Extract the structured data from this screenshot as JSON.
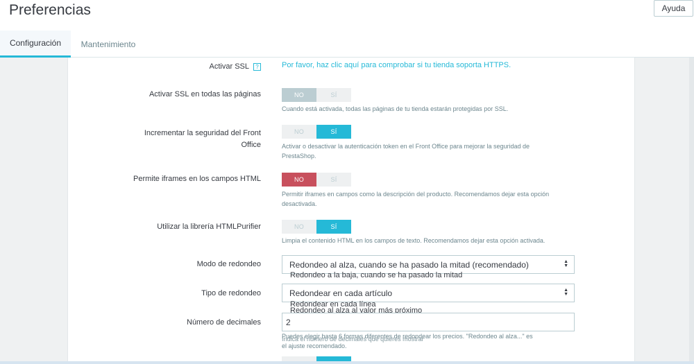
{
  "header": {
    "title": "Preferencias",
    "help_label": "Ayuda",
    "tabs": [
      {
        "label": "Configuración",
        "active": true
      },
      {
        "label": "Mantenimiento",
        "active": false
      }
    ]
  },
  "settings": {
    "ssl": {
      "label": "Activar SSL",
      "help_icon": "?",
      "link": "Por favor, haz clic aquí para comprobar si tu tienda soporta HTTPS."
    },
    "ssl_all": {
      "label": "Activar SSL en todas las páginas",
      "no": "NO",
      "yes": "SÍ",
      "value": "no",
      "help": "Cuando está activada, todas las páginas de tu tienda estarán protegidas por SSL."
    },
    "front_security": {
      "label_line1": "Incrementar la seguridad del Front",
      "label_line2": "Office",
      "no": "NO",
      "yes": "SÍ",
      "value": "yes",
      "help_line1": "Activar o desactivar la autenticación token en el Front Office para mejorar la seguridad de",
      "help_line2": "PrestaShop."
    },
    "iframes": {
      "label": "Permite iframes en los campos HTML",
      "no": "NO",
      "yes": "SÍ",
      "value": "no",
      "help_line1": "Permitir iframes en campos como la descripción del producto. Recomendamos dejar esta opción",
      "help_line2": "desactivada."
    },
    "purifier": {
      "label": "Utilizar la librería HTMLPurifier",
      "no": "NO",
      "yes": "SÍ",
      "value": "yes",
      "help": "Limpia el contenido HTML en los campos de texto. Recomendamos dejar esta opción activada."
    },
    "round_mode": {
      "label": "Modo de redondeo",
      "selected": "Redondeo al alza, cuando se ha pasado la mitad (recomendado)",
      "overflow_option": "Redondeo a la baja, cuando se ha pasado la mitad"
    },
    "round_type": {
      "label": "Tipo de redondeo",
      "selected": "Redondear en cada artículo",
      "overflow_option1": "Redondear en cada línea",
      "overflow_option2": "Redondeo al alza al valor más próximo"
    },
    "decimals": {
      "label": "Número de decimales",
      "value": "2",
      "help_line1": "Puedes elegir hasta 6 formas diferentes de redondear los precios. \"Redondeo al alza...\" es",
      "help_line2": "el ajuste recomendado.",
      "help_overlap": "Indica el número de decimales que quieres mostrar"
    }
  }
}
